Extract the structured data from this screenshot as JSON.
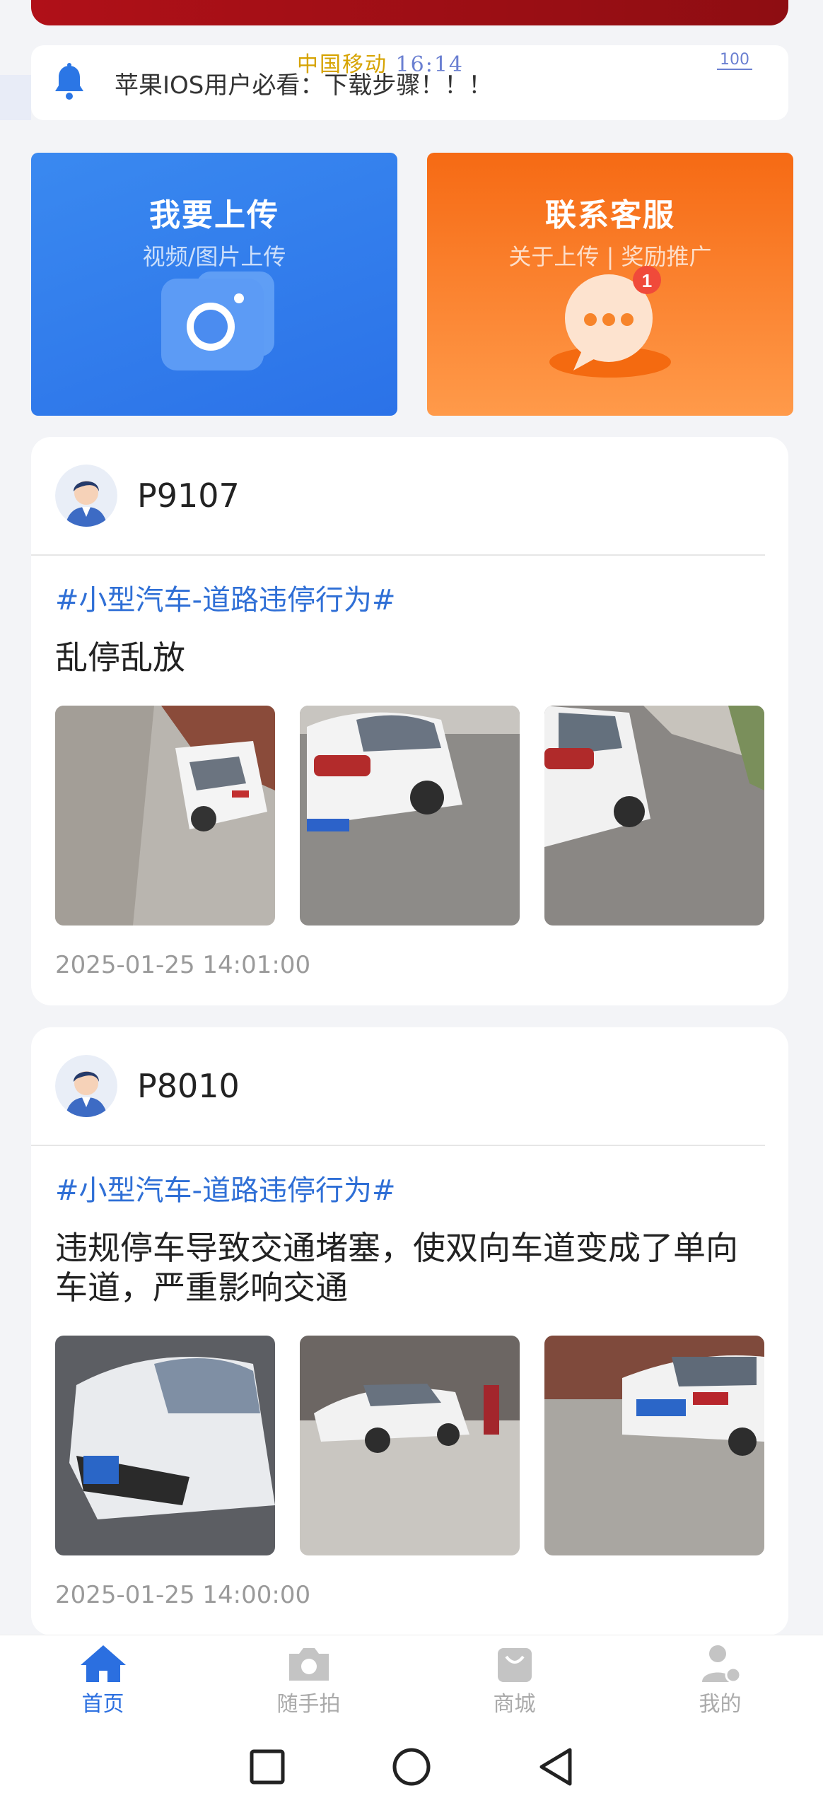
{
  "status_bar": {
    "carrier": "中国移动",
    "time": "16:14",
    "battery": "100"
  },
  "notice": {
    "icon": "bell-icon",
    "text": "苹果IOS用户必看：下载步骤！！！"
  },
  "tiles": [
    {
      "title": "我要上传",
      "subtitle": "视频/图片上传",
      "icon": "camera-icon",
      "color": "#2f7ded"
    },
    {
      "title": "联系客服",
      "subtitle": "关于上传 | 奖励推广",
      "icon": "chat-bubble-icon",
      "badge": "1",
      "color": "#f77a24"
    }
  ],
  "posts": [
    {
      "user": "P9107",
      "tag": "#小型汽车-道路违停行为#",
      "text": "乱停乱放",
      "timestamp": "2025-01-25 14:01:00"
    },
    {
      "user": "P8010",
      "tag": "#小型汽车-道路违停行为#",
      "text": "违规停车导致交通堵塞，使双向车道变成了单向车道，严重影响交通",
      "timestamp": "2025-01-25 14:00:00"
    }
  ],
  "tabbar": {
    "active_color": "#2b6fe0",
    "items": [
      {
        "label": "首页",
        "icon": "home-icon",
        "active": true
      },
      {
        "label": "随手拍",
        "icon": "camera-icon",
        "active": false
      },
      {
        "label": "商城",
        "icon": "shopping-bag-icon",
        "active": false
      },
      {
        "label": "我的",
        "icon": "user-icon",
        "active": false
      }
    ]
  }
}
